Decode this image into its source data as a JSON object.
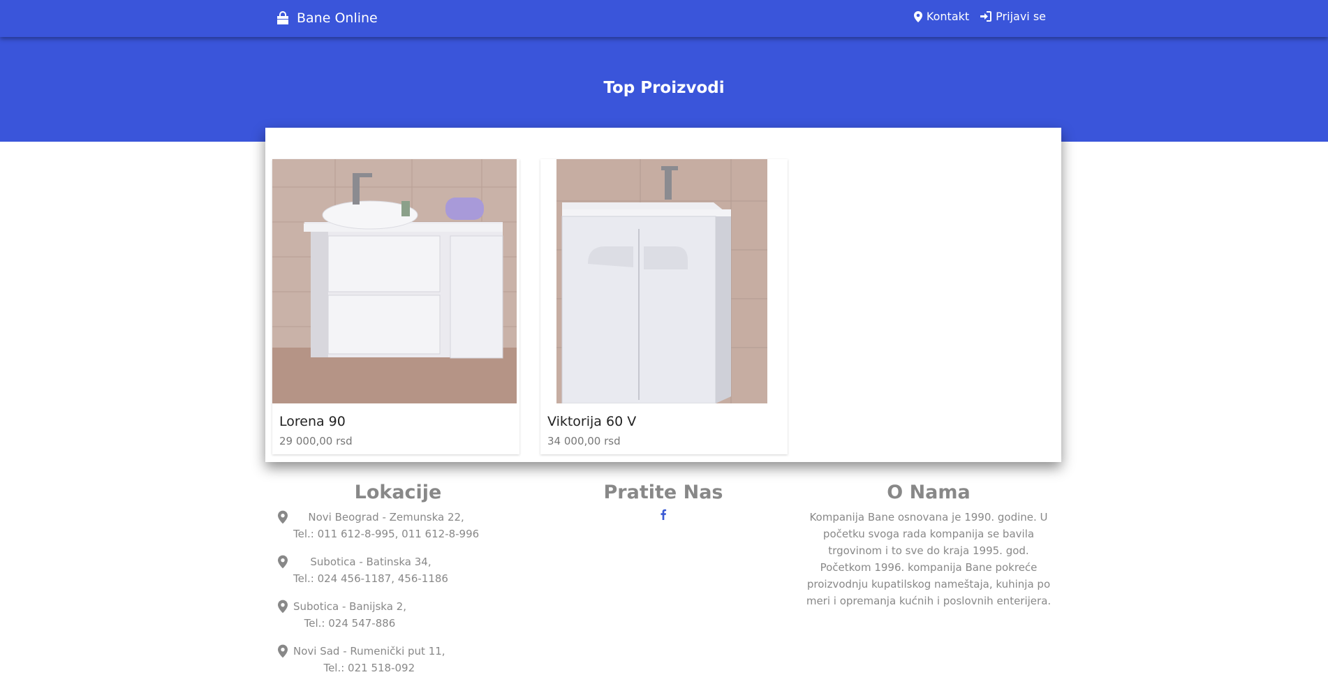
{
  "nav": {
    "brand": "Bane Online",
    "brand_icon": "shopping-bag-icon",
    "links": [
      {
        "label": "Kontakt",
        "icon": "map-marker-icon"
      },
      {
        "label": "Prijavi se",
        "icon": "sign-in-icon"
      }
    ]
  },
  "hero": {
    "title": "Top Proizvodi"
  },
  "products": [
    {
      "name": "Lorena 90",
      "price": "29 000,00 rsd"
    },
    {
      "name": "Viktorija 60 V",
      "price": "34 000,00 rsd"
    }
  ],
  "footer": {
    "locations_title": "Lokacije",
    "locations": [
      {
        "line1": "Novi Beograd - Zemunska 22,",
        "line2": "Tel.: 011 612-8-995, 011 612-8-996"
      },
      {
        "line1": "Subotica - Batinska 34,",
        "line2": "Tel.: 024 456-1187, 456-1186"
      },
      {
        "line1": "Subotica - Banijska 2,",
        "line2": "Tel.: 024 547-886"
      },
      {
        "line1": "Novi Sad - Rumenički put 11,",
        "line2": "Tel.: 021 518-092"
      }
    ],
    "follow_title": "Pratite Nas",
    "social_icon": "facebook-icon",
    "about_title": "O Nama",
    "about_text": "Kompanija Bane osnovana je 1990. godine. U početku svoga rada kompanija se bavila trgovinom i to sve do kraja 1995. god. Početkom 1996. kompanija Bane pokreće proizvodnju kupatilskog nameštaja, kuhinja po meri i opremanja kućnih i poslovnih enterijera."
  },
  "colors": {
    "primary": "#3a55da",
    "link_blue": "#3b5ad4",
    "muted_text": "#888888"
  }
}
